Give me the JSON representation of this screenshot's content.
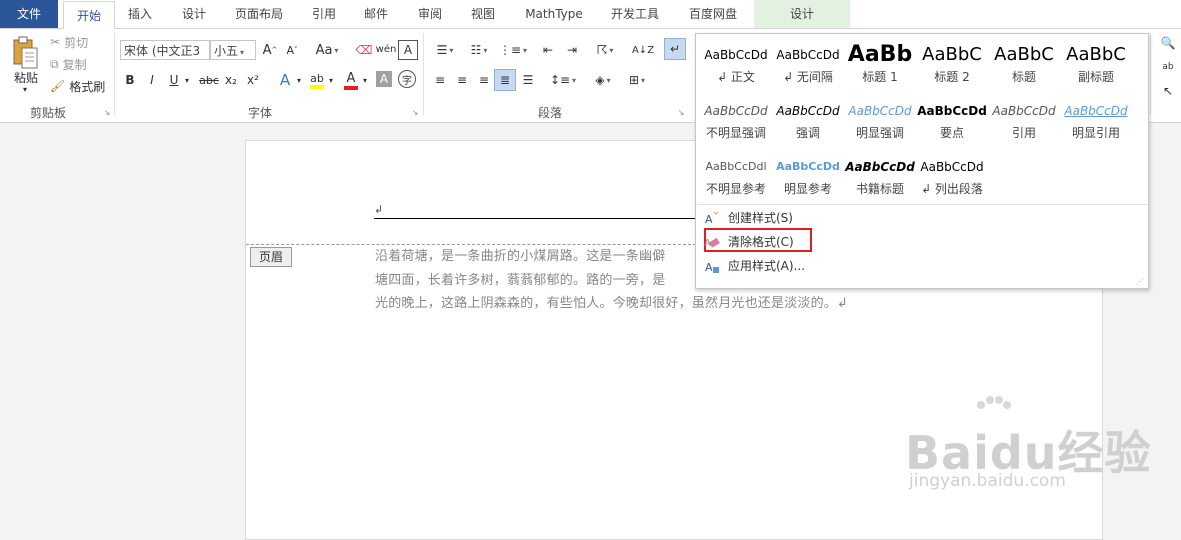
{
  "tabs": [
    "文件",
    "开始",
    "插入",
    "设计",
    "页面布局",
    "引用",
    "邮件",
    "审阅",
    "视图",
    "MathType",
    "开发工具",
    "百度网盘",
    "设计"
  ],
  "clipboard": {
    "paste": "粘贴",
    "cut": "剪切",
    "copy": "复制",
    "format_painter": "格式刷",
    "group_label": "剪贴板"
  },
  "font": {
    "font_name": "宋体 (中文正3",
    "font_size": "小五",
    "group_label": "字体",
    "bold": "B",
    "italic": "I",
    "underline": "U",
    "strike": "abc",
    "subscript": "x₂",
    "superscript": "x²",
    "grow": "A",
    "shrink": "A",
    "change_case": "Aa",
    "text_effect": "A",
    "font_color": "A",
    "char_shading": "A",
    "enclose": "字"
  },
  "paragraph": {
    "group_label": "段落",
    "sort": "A↓Z"
  },
  "styles": [
    {
      "sample": "AaBbCcDd",
      "name": "↲ 正文"
    },
    {
      "sample": "AaBbCcDd",
      "name": "↲ 无间隔"
    },
    {
      "sample": "AaBb",
      "name": "标题 1"
    },
    {
      "sample": "AaBbC",
      "name": "标题 2"
    },
    {
      "sample": "AaBbC",
      "name": "标题"
    },
    {
      "sample": "AaBbC",
      "name": "副标题"
    },
    {
      "sample": "AaBbCcDd",
      "name": "不明显强调"
    },
    {
      "sample": "AaBbCcDd",
      "name": "强调"
    },
    {
      "sample": "AaBbCcDd",
      "name": "明显强调"
    },
    {
      "sample": "AaBbCcDd",
      "name": "要点"
    },
    {
      "sample": "AaBbCcDd",
      "name": "引用"
    },
    {
      "sample": "AaBbCcDd",
      "name": "明显引用"
    },
    {
      "sample": "AaBbCcDdl",
      "name": "不明显参考"
    },
    {
      "sample": "AaBbCcDd",
      "name": "明显参考"
    },
    {
      "sample": "AaBbCcDd",
      "name": "书籍标题"
    },
    {
      "sample": "AaBbCcDd",
      "name": "↲ 列出段落"
    }
  ],
  "menu": {
    "create": "创建样式(S)",
    "clear": "清除格式(C)",
    "apply": "应用样式(A)..."
  },
  "document": {
    "header_tag": "页眉",
    "para_mark": "↲",
    "line1": "沿着荷塘，是一条曲折的小煤屑路。这是一条幽僻",
    "line2": "塘四面，长着许多树，蓊蓊郁郁的。路的一旁，是",
    "line3": "光的晚上，这路上阴森森的，有些怕人。今晚却很好，虽然月光也还是淡淡的。↲"
  },
  "watermark": {
    "brand": "Baidu经验",
    "url": "jingyan.baidu.com"
  },
  "colors": {
    "file_tab": "#2b579a",
    "highlight": "#e02020",
    "design_tab": "#e3f1e0"
  }
}
